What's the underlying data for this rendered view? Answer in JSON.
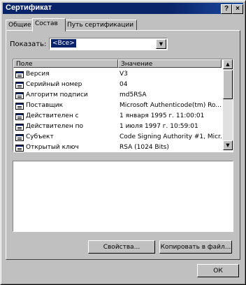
{
  "window": {
    "title": "Сертификат",
    "help_glyph": "?",
    "close_glyph": "×"
  },
  "tabs": [
    {
      "label": "Общие",
      "active": false
    },
    {
      "label": "Состав",
      "active": true
    },
    {
      "label": "Путь сертификации",
      "active": false
    }
  ],
  "show": {
    "label": "Показать:",
    "selected": "<Все>"
  },
  "table": {
    "columns": [
      "Поле",
      "Значение"
    ],
    "rows": [
      {
        "field": "Версия",
        "value": "V3"
      },
      {
        "field": "Серийный номер",
        "value": "04"
      },
      {
        "field": "Алгоритм подписи",
        "value": "md5RSA"
      },
      {
        "field": "Поставщик",
        "value": "Microsoft Authenticode(tm) Ro..."
      },
      {
        "field": "Действителен с",
        "value": "1 января 1995 г. 11:00:01"
      },
      {
        "field": "Действителен по",
        "value": "1 июля 1997 г. 10:59:01"
      },
      {
        "field": "Субъект",
        "value": "Code Signing Authority #1, Micr..."
      },
      {
        "field": "Открытый ключ",
        "value": "RSA (1024 Bits)"
      }
    ]
  },
  "buttons": {
    "properties": "Свойства...",
    "copy_to_file": "Копировать в файл...",
    "ok": "ОК"
  }
}
